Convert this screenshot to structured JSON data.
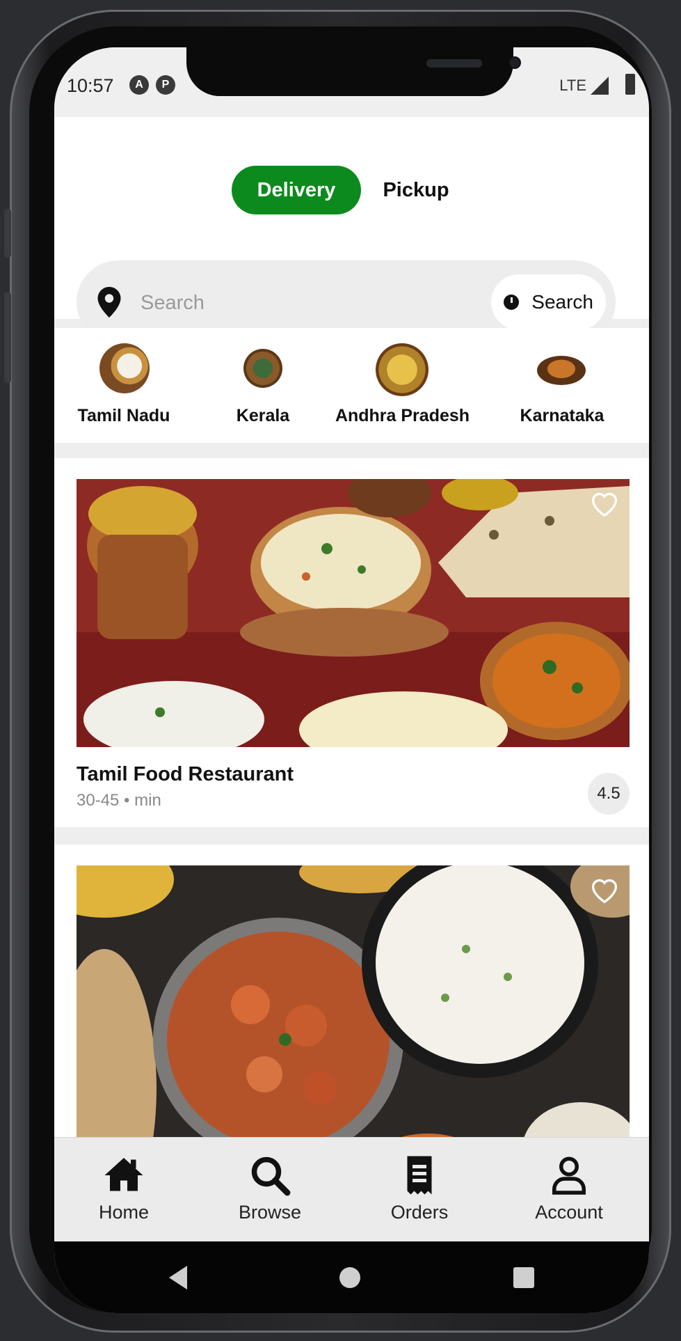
{
  "status_bar": {
    "time": "10:57",
    "network": "LTE",
    "icons": [
      "a-notification-icon",
      "p-notification-icon",
      "signal-icon",
      "battery-icon"
    ]
  },
  "mode_tabs": {
    "active": "Delivery",
    "inactive": "Pickup"
  },
  "search": {
    "placeholder": "Search",
    "button_label": "Search",
    "icons": [
      "location-pin-icon",
      "clock-icon"
    ]
  },
  "categories": [
    {
      "label": "Tamil Nadu"
    },
    {
      "label": "Kerala"
    },
    {
      "label": "Andhra Pradesh"
    },
    {
      "label": "Karnataka"
    }
  ],
  "restaurants": [
    {
      "name": "Tamil Food Restaurant",
      "time": "30-45 • min",
      "rating": "4.5",
      "favorite_icon": "heart-outline-icon"
    },
    {
      "favorite_icon": "heart-outline-icon"
    }
  ],
  "bottom_nav": [
    {
      "label": "Home",
      "icon": "home-icon"
    },
    {
      "label": "Browse",
      "icon": "search-icon"
    },
    {
      "label": "Orders",
      "icon": "receipt-icon"
    },
    {
      "label": "Account",
      "icon": "account-icon"
    }
  ],
  "system_nav": [
    "back-icon",
    "home-circle-icon",
    "recents-icon"
  ],
  "colors": {
    "accent": "#0d8a1e",
    "background": "#eeeeee",
    "card": "#ffffff",
    "frame": "#2c2d30"
  }
}
